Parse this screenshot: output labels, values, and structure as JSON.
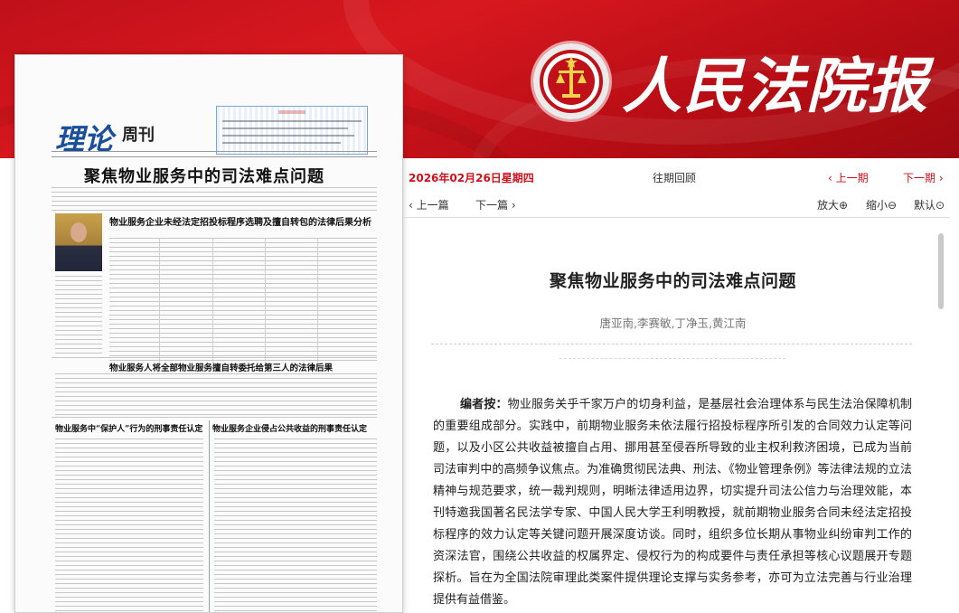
{
  "colors": {
    "brand_red": "#d0101c",
    "banner_red": "#c0101a",
    "thumbnail_blue": "#1b4f9c"
  },
  "masthead": {
    "title": "人民法院报",
    "emblem_icon": "court-emblem-icon"
  },
  "paper": {
    "logo": "理论",
    "logo_suffix": "周刊",
    "headline": "聚焦物业服务中的司法难点问题",
    "subheads": [
      "物业服务企业未经法定招投标程序选聘及擅自转包的法律后果分析",
      "物业服务人将全部物业服务擅自转委托给第三人的法律后果",
      "物业服务中“保护人”行为的刑事责任认定",
      "物业服务企业侵占公共收益的刑事责任认定"
    ]
  },
  "nav": {
    "date": "2026年02月26日星期四",
    "archive": "往期回顾",
    "prev_issue": "‹ 上一期",
    "next_issue": "下一期 ›",
    "prev_article": "‹ 上一篇",
    "next_article": "下一篇 ›",
    "zoom_in": "放大⊕",
    "zoom_out": "缩小⊖",
    "zoom_reset": "默认⊙"
  },
  "article": {
    "title": "聚焦物业服务中的司法难点问题",
    "authors": "唐亚南,李赛敏,丁净玉,黄江南",
    "lead_label": "编者按：",
    "lead_text": "物业服务关乎千家万户的切身利益，是基层社会治理体系与民生法治保障机制的重要组成部分。实践中，前期物业服务未依法履行招投标程序所引发的合同效力认定等问题，以及小区公共收益被擅自占用、挪用甚至侵吞所导致的业主权利救济困境，已成为当前司法审判中的高频争议焦点。为准确贯彻民法典、刑法、《物业管理条例》等法律法规的立法精神与规范要求，统一裁判规则，明晰法律适用边界，切实提升司法公信力与治理效能，本刊特邀我国著名民法学专家、中国人民大学王利明教授，就前期物业服务合同未经法定招投标程序的效力认定等关键问题开展深度访谈。同时，组织多位长期从事物业纠纷审判工作的资深法官，围绕公共收益的权属界定、侵权行为的构成要件与责任承担等核心议题展开专题探析。旨在为全国法院审理此类案件提供理论支撑与实务参考，亦可为立法完善与行业治理提供有益借鉴。"
  }
}
